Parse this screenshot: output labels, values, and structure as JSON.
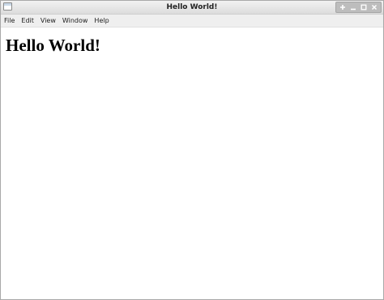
{
  "window": {
    "title": "Hello World!",
    "controls": [
      {
        "name": "pin-icon",
        "glyph": "✚"
      },
      {
        "name": "minimize-icon",
        "glyph": "_"
      },
      {
        "name": "maximize-icon",
        "glyph": "□"
      },
      {
        "name": "close-icon",
        "glyph": "✕"
      }
    ]
  },
  "menubar": {
    "items": [
      "File",
      "Edit",
      "View",
      "Window",
      "Help"
    ]
  },
  "content": {
    "heading": "Hello World!"
  }
}
